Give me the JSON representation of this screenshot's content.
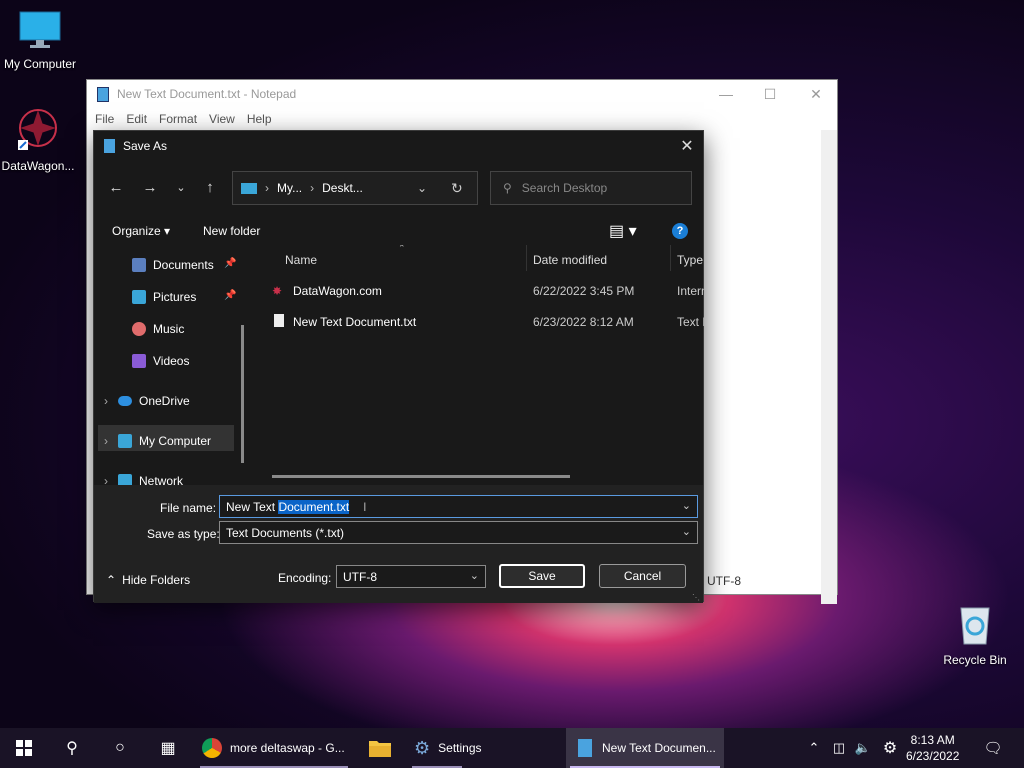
{
  "desktop": {
    "icons": [
      {
        "label": "My Computer"
      },
      {
        "label": "DataWagon..."
      },
      {
        "label": "Recycle Bin"
      }
    ]
  },
  "notepad": {
    "title": "New Text Document.txt - Notepad",
    "menu": [
      "File",
      "Edit",
      "Format",
      "View",
      "Help"
    ],
    "status_encoding": "UTF-8"
  },
  "dialog": {
    "title": "Save As",
    "breadcrumb": [
      "My...",
      "Deskt..."
    ],
    "search_placeholder": "Search Desktop",
    "organize": "Organize",
    "new_folder": "New folder",
    "sidebar": [
      {
        "label": "Documents",
        "pinned": true,
        "color": "#5b7fbf"
      },
      {
        "label": "Pictures",
        "pinned": true,
        "color": "#3aa6d8"
      },
      {
        "label": "Music",
        "pinned": false,
        "color": "#e06c6c"
      },
      {
        "label": "Videos",
        "pinned": false,
        "color": "#8a5bd6"
      },
      {
        "label": "OneDrive",
        "pinned": false,
        "color": "#2d8fe0"
      },
      {
        "label": "My Computer",
        "pinned": false,
        "color": "#3aa6d8"
      },
      {
        "label": "Network",
        "pinned": false,
        "color": "#3aa6d8"
      }
    ],
    "columns": [
      "Name",
      "Date modified",
      "Type"
    ],
    "files": [
      {
        "name": "DataWagon.com",
        "date": "6/22/2022 3:45 PM",
        "type": "Intern"
      },
      {
        "name": "New Text Document.txt",
        "date": "6/23/2022 8:12 AM",
        "type": "Text D"
      }
    ],
    "file_name_label": "File name:",
    "file_name_prefix": "New Text ",
    "file_name_selected": "Document.txt",
    "save_type_label": "Save as type:",
    "save_type_value": "Text Documents (*.txt)",
    "hide_folders": "Hide Folders",
    "encoding_label": "Encoding:",
    "encoding_value": "UTF-8",
    "save": "Save",
    "cancel": "Cancel"
  },
  "taskbar": {
    "chrome_label": "more deltaswap - G...",
    "settings_label": "Settings",
    "notepad_label": "New Text Documen...",
    "time": "8:13 AM",
    "date": "6/23/2022"
  }
}
